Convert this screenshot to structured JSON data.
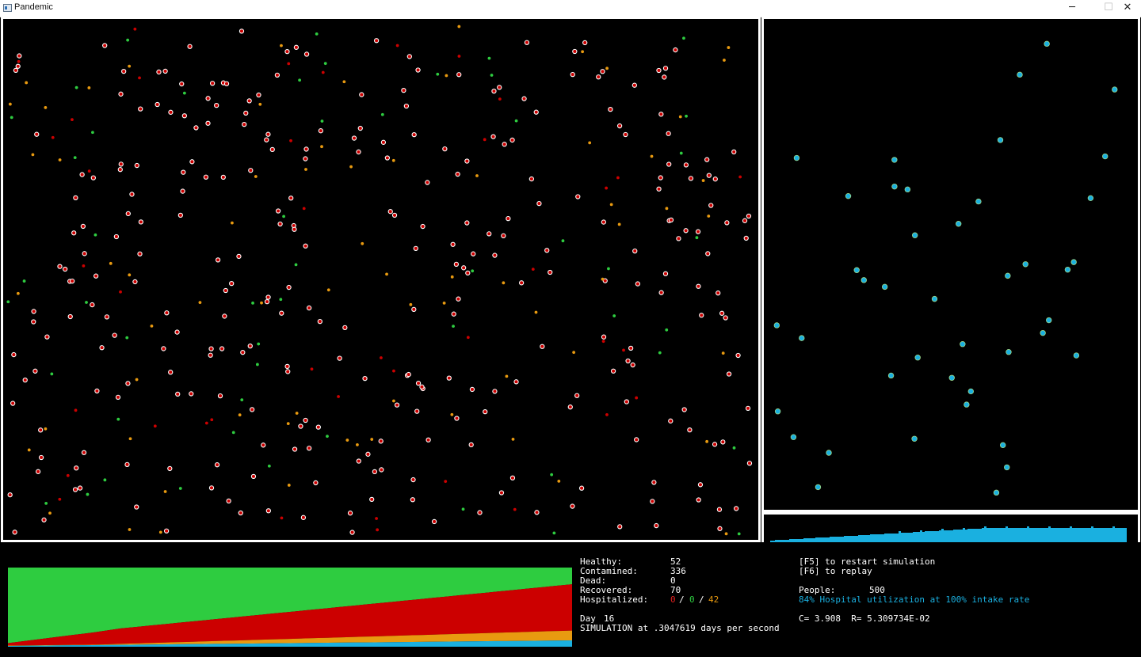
{
  "window": {
    "title": "Pandemic",
    "icon": "app-icon",
    "controls": [
      "─",
      "☐",
      "✕"
    ]
  },
  "colors": {
    "healthy": "#2ecc40",
    "contamined": "#cc0000",
    "hospitalized": "#e89a10",
    "recovered": "#1ab0e0",
    "dot_outline": "#ffffff",
    "background": "#000000"
  },
  "stats": {
    "healthy_label": "Healthy:",
    "healthy_value": "52",
    "contamined_label": "Contamined:",
    "contamined_value": "336",
    "dead_label": "Dead:",
    "dead_value": "0",
    "recovered_label": "Recovered:",
    "recovered_value": "70",
    "hospitalized_label": "Hospitalized:",
    "hosp_a": "0",
    "sep1": "/",
    "hosp_b": "0",
    "sep2": "/",
    "hosp_c": "42",
    "day_label": "Day",
    "day_value": "16",
    "speed_text": "SIMULATION at .3047619 days per second"
  },
  "controls": {
    "restart": "[F5] to restart simulation",
    "replay": "[F6] to replay",
    "people_label": "People:",
    "people_value": "500",
    "utilization": "84% Hospital utilization at 100% intake rate",
    "c_r_text": "C= 3.908  R= 5.309734E-02"
  },
  "population": {
    "total": 500,
    "healthy": 52,
    "contamined": 336,
    "dead": 0,
    "recovered": 70,
    "hospitalized": 42,
    "hospital_beds_shown": 42
  },
  "hospital_utilization_pct": 84,
  "intake_rate_pct": 100,
  "day": 16
}
